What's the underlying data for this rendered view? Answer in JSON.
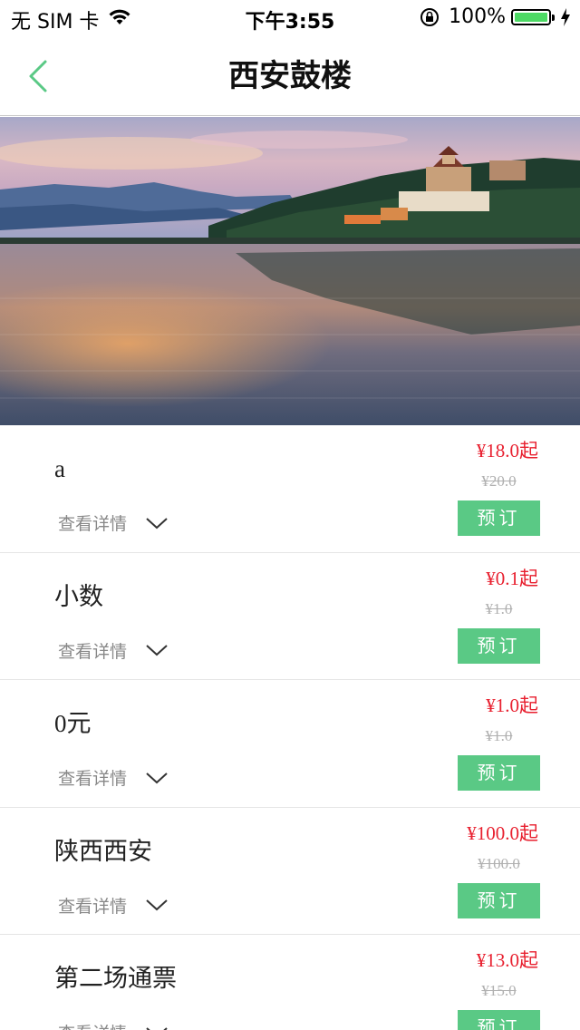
{
  "status_bar": {
    "carrier": "无 SIM 卡",
    "time": "下午3:55",
    "battery": "100%",
    "battery_level": 1.0,
    "icons": [
      "wifi-icon",
      "rotation-lock-icon",
      "battery-icon",
      "charging-icon"
    ]
  },
  "nav": {
    "title": "西安鼓楼",
    "back_icon": "chevron-left-icon",
    "accent_color": "#5ac985"
  },
  "banner": {
    "icon": "lake-landscape-photo"
  },
  "tickets": [
    {
      "name": "a",
      "detail_label": "查看详情",
      "price": "¥18.0起",
      "original_price": "¥20.0",
      "book_label": "预订"
    },
    {
      "name": "小数",
      "detail_label": "查看详情",
      "price": "¥0.1起",
      "original_price": "¥1.0",
      "book_label": "预订"
    },
    {
      "name": "0元",
      "detail_label": "查看详情",
      "price": "¥1.0起",
      "original_price": "¥1.0",
      "book_label": "预订"
    },
    {
      "name": "陕西西安",
      "detail_label": "查看详情",
      "price": "¥100.0起",
      "original_price": "¥100.0",
      "book_label": "预订"
    },
    {
      "name": "第二场通票",
      "detail_label": "查看详情",
      "price": "¥13.0起",
      "original_price": "¥15.0",
      "book_label": "预订"
    }
  ],
  "colors": {
    "price": "#e8202f",
    "button": "#5ac985",
    "original_price": "#b0b0b0"
  }
}
